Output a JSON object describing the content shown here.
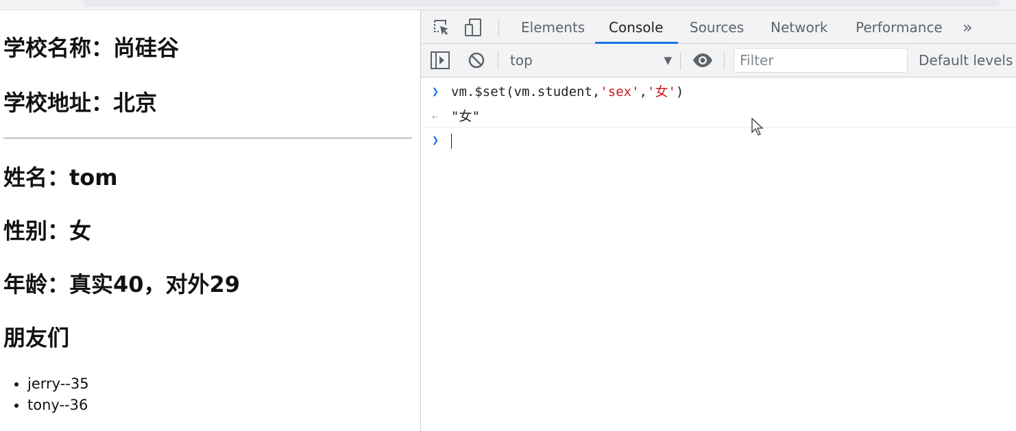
{
  "page": {
    "school_name": "学校名称：尚硅谷",
    "school_address": "学校地址：北京",
    "student_name": "姓名：tom",
    "student_sex": "性别：女",
    "student_age": "年龄：真实40，对外29",
    "friends_title": "朋友们",
    "friends": [
      "jerry--35",
      "tony--36"
    ]
  },
  "devtools": {
    "tabs": [
      "Elements",
      "Console",
      "Sources",
      "Network",
      "Performance"
    ],
    "active_tab": "Console",
    "more_tabs": "»",
    "toolbar": {
      "context": "top",
      "filter_placeholder": "Filter",
      "levels": "Default levels"
    },
    "console": {
      "input_prefix": "vm.$set(vm.student,",
      "input_arg1": "'sex'",
      "input_comma": ",",
      "input_arg2": "'女'",
      "input_suffix": ")",
      "output": "\"女\""
    },
    "colors": {
      "accent": "#1a73e8",
      "string": "#c41a16",
      "prompt": "#1a73e8",
      "muted": "#5f6368"
    },
    "icons": [
      "inspect-element-icon",
      "device-toolbar-icon",
      "sidebar-toggle-icon",
      "clear-console-icon",
      "eye-icon",
      "mouse-cursor-icon"
    ]
  }
}
